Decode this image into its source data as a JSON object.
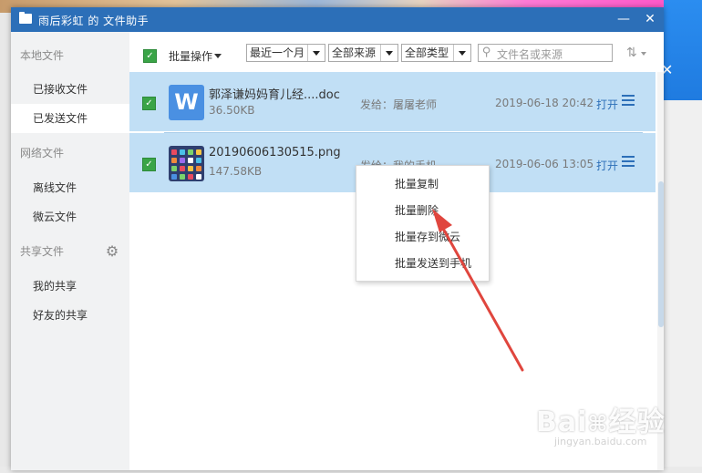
{
  "window": {
    "title": "雨后彩虹 的 文件助手",
    "minimize_glyph": "—",
    "close_glyph": "✕"
  },
  "sidebar": {
    "local_section": "本地文件",
    "received": "已接收文件",
    "sent": "已发送文件",
    "network_section": "网络文件",
    "offline": "离线文件",
    "weiyun": "微云文件",
    "share_section": "共享文件",
    "my_share": "我的共享",
    "friends_share": "好友的共享"
  },
  "toolbar": {
    "batch_label": "批量操作",
    "time_filter": "最近一个月",
    "source_filter": "全部来源",
    "type_filter": "全部类型",
    "search_placeholder": "文件名或来源"
  },
  "files": [
    {
      "name": "郭泽谦妈妈育儿经....doc",
      "size": "36.50KB",
      "sent_to": "发给：屠屠老师",
      "date": "2019-06-18 20:42",
      "open_label": "打开",
      "icon": "word-doc-icon"
    },
    {
      "name": "20190606130515.png",
      "size": "147.58KB",
      "sent_to": "发给：我的手机",
      "date": "2019-06-06 13:05",
      "open_label": "打开",
      "icon": "image-thumbnail-icon"
    }
  ],
  "context_menu": {
    "items": [
      "批量复制",
      "批量删除",
      "批量存到微云",
      "批量发送到手机"
    ]
  },
  "colors": {
    "titlebar": "#2c6fb8",
    "selected_row": "#c1dff5",
    "checkbox": "#3aa447",
    "arrow": "#e0463e"
  }
}
